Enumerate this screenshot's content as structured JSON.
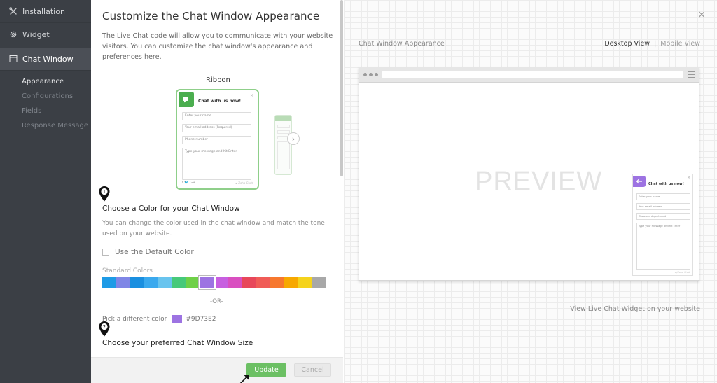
{
  "sidebar": {
    "items": [
      {
        "label": "Installation",
        "icon": "tools-icon"
      },
      {
        "label": "Widget",
        "icon": "gear-icon"
      },
      {
        "label": "Chat Window",
        "icon": "window-icon",
        "active": true
      }
    ],
    "sub_items": [
      {
        "label": "Appearance",
        "active": true
      },
      {
        "label": "Configurations"
      },
      {
        "label": "Fields"
      },
      {
        "label": "Response Message"
      }
    ]
  },
  "panel": {
    "title": "Customize the Chat Window Appearance",
    "description": "The Live Chat code will allow you to communicate with your website visitors. You can customize the chat window's appearance and preferences here.",
    "ribbon_label": "Ribbon",
    "ribbon_preview": {
      "title": "Chat with us now!",
      "close": "×",
      "fields": [
        "Enter your name",
        "Your email address (Required)",
        "Phone number",
        "Type your message and hit Enter"
      ],
      "social": "f  🐦  G+",
      "powered": "◀ Zoho Chat",
      "accent": "#4bae4f"
    },
    "step1": {
      "number": "1",
      "title": "Choose a Color for your Chat Window",
      "description": "You can change the color used in the chat window and match the tone used on your website.",
      "default_color_label": "Use the Default Color",
      "standard_colors_label": "Standard Colors",
      "swatches": [
        "#1e9be6",
        "#7f86e6",
        "#1a8fe0",
        "#3aa9ee",
        "#69c4ee",
        "#47c97a",
        "#6fd048",
        "#9d73e2",
        "#c75fe0",
        "#d94fc0",
        "#e8475a",
        "#f05c57",
        "#f7782e",
        "#f7a800",
        "#f5d31c",
        "#a8a8a8"
      ],
      "selected_index": 7,
      "or_text": "-OR-",
      "pick_label": "Pick a different color",
      "picked_color": "#9D73E2"
    },
    "step2": {
      "number": "2",
      "title": "Choose your preferred Chat Window Size"
    },
    "footer": {
      "update_label": "Update",
      "cancel_label": "Cancel"
    }
  },
  "preview": {
    "label": "Chat Window Appearance",
    "desktop_view": "Desktop View",
    "separator": "|",
    "mobile_view": "Mobile View",
    "watermark": "PREVIEW",
    "close": "×",
    "mini_chat": {
      "title": "Chat with us now!",
      "close": "×",
      "fields": [
        "Enter your name",
        "Your email address",
        "Choose a department",
        "Type your message and hit Enter"
      ],
      "powered": "◀ Zoho Chat",
      "accent": "#9d73e2"
    },
    "view_live": "View Live Chat Widget on your website"
  }
}
